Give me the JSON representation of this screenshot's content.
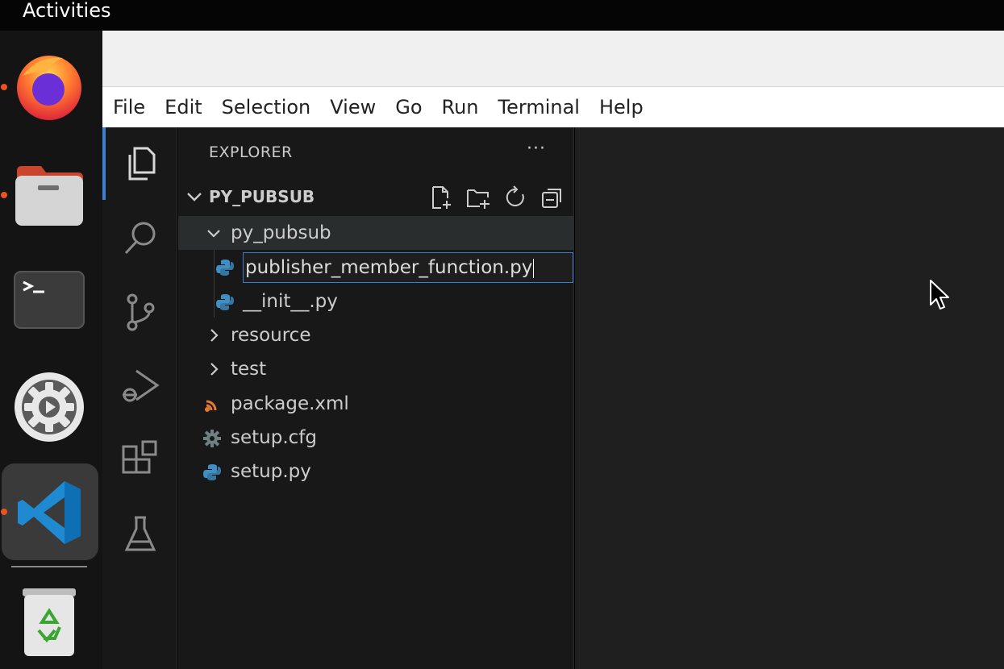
{
  "topbar": {
    "activities": "Activities"
  },
  "dock": {
    "apps": [
      {
        "name": "Firefox",
        "icon": "firefox-icon",
        "running": true
      },
      {
        "name": "Files",
        "icon": "files-icon",
        "running": true
      },
      {
        "name": "Terminal",
        "icon": "terminal-icon",
        "running": false
      },
      {
        "name": "Settings",
        "icon": "settings-icon",
        "running": false
      },
      {
        "name": "Visual Studio Code",
        "icon": "vscode-icon",
        "running": true,
        "active": true
      },
      {
        "name": "Trash",
        "icon": "trash-icon",
        "running": false
      }
    ],
    "running_dot_color": "#e95420"
  },
  "menubar": {
    "items": [
      "File",
      "Edit",
      "Selection",
      "View",
      "Go",
      "Run",
      "Terminal",
      "Help"
    ]
  },
  "activitybar": {
    "items": [
      "explorer-icon",
      "search-icon",
      "source-control-icon",
      "run-debug-icon",
      "extensions-icon",
      "testing-icon"
    ],
    "accent_color": "#3b7fd6"
  },
  "explorer": {
    "title": "EXPLORER",
    "more": "···",
    "workspace": "PY_PUBSUB",
    "toolbar": [
      "new-file-icon",
      "new-folder-icon",
      "refresh-icon",
      "collapse-all-icon"
    ],
    "tree": {
      "folder": "py_pubsub",
      "rename_value": "publisher_member_function.py",
      "child_file": "__init__.py",
      "folders": [
        "resource",
        "test"
      ],
      "files": [
        "package.xml",
        "setup.cfg",
        "setup.py"
      ]
    }
  },
  "colors": {
    "python_icon": "#3f8fc4",
    "xml_icon": "#e37933",
    "cfg_icon": "#6d8086",
    "sidebar_bg": "#181818",
    "editor_bg": "#1f1f1f"
  }
}
